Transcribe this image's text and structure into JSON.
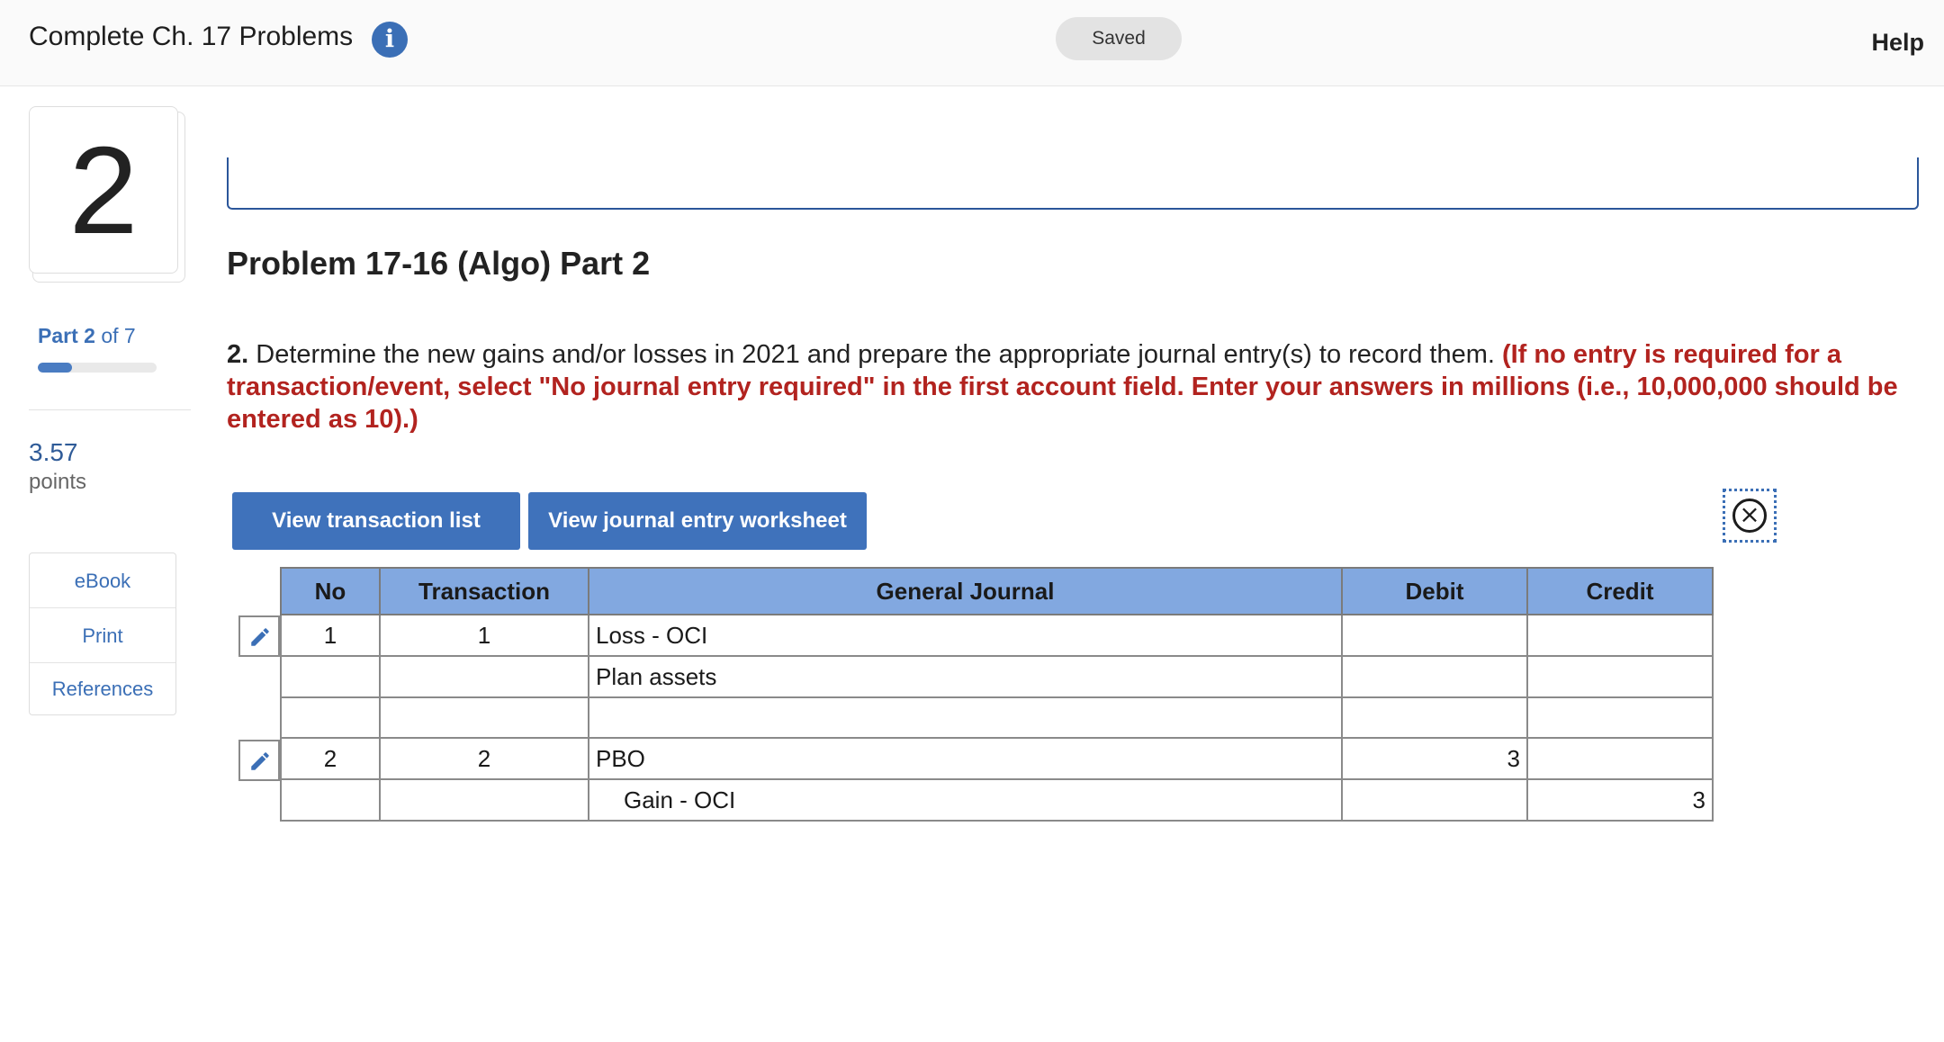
{
  "header": {
    "title": "Complete Ch. 17 Problems",
    "info_icon": "info-icon",
    "status": "Saved",
    "help": "Help"
  },
  "sidebar": {
    "question_number": "2",
    "part_current": "Part 2",
    "part_total": "of 7",
    "progress_fraction": 0.2857,
    "points_value": "3.57",
    "points_label": "points",
    "links": [
      {
        "label": "eBook"
      },
      {
        "label": "Print"
      },
      {
        "label": "References"
      }
    ]
  },
  "main": {
    "problem_title": "Problem 17-16 (Algo) Part 2",
    "question_number": "2.",
    "question_text": " Determine the new gains and/or losses in 2021 and prepare the appropriate journal entry(s) to record them. ",
    "instruction_text": "(If no entry is required for a transaction/event, select \"No journal entry required\" in the first account field. Enter your answers in millions (i.e., 10,000,000 should be entered as 10).)",
    "buttons": {
      "view_transaction_list": "View transaction list",
      "view_journal_worksheet": "View journal entry worksheet"
    },
    "close_icon": "close-circle-icon"
  },
  "journal": {
    "columns": [
      "No",
      "Transaction",
      "General Journal",
      "Debit",
      "Credit"
    ],
    "rows": [
      {
        "no": "1",
        "transaction": "1",
        "account": "Loss - OCI",
        "debit": "",
        "credit": ""
      },
      {
        "no": "",
        "transaction": "",
        "account": "Plan assets",
        "debit": "",
        "credit": ""
      },
      {
        "no": "",
        "transaction": "",
        "account": "",
        "debit": "",
        "credit": ""
      },
      {
        "no": "2",
        "transaction": "2",
        "account": "PBO",
        "debit": "3",
        "credit": ""
      },
      {
        "no": "",
        "transaction": "",
        "account": "Gain - OCI",
        "debit": "",
        "credit": "3"
      }
    ],
    "edit_icon": "pencil-icon"
  },
  "colors": {
    "accent": "#3f72bb",
    "table_header": "#82a8e0",
    "instruction_red": "#b2231f"
  }
}
